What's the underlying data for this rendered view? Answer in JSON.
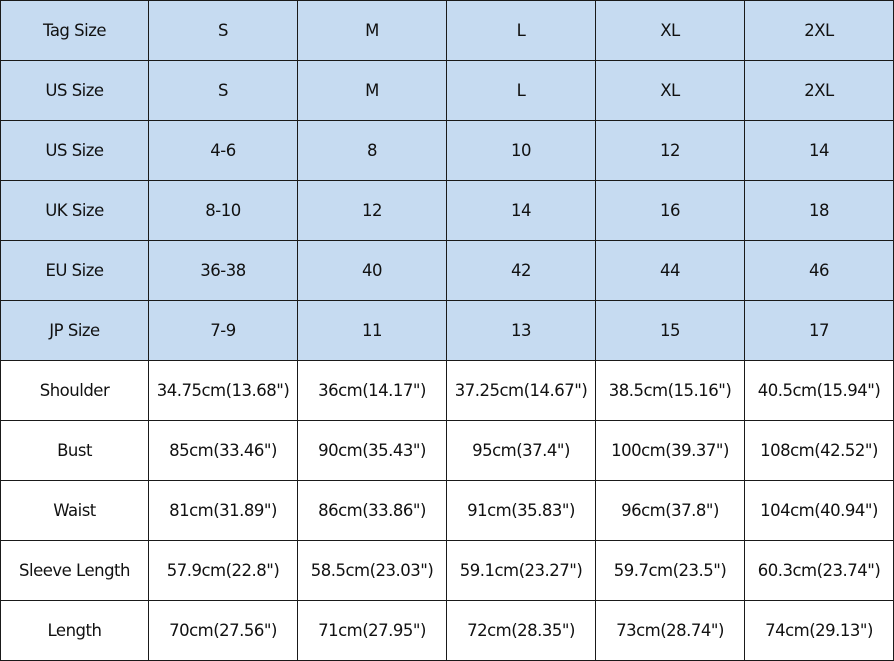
{
  "colors": {
    "header_bg": "#c6dbf1",
    "body_bg": "#ffffff",
    "border": "#1a1a1a"
  },
  "size_rows": [
    {
      "label": "Tag Size",
      "values": [
        "S",
        "M",
        "L",
        "XL",
        "2XL"
      ]
    },
    {
      "label": "US Size",
      "values": [
        "S",
        "M",
        "L",
        "XL",
        "2XL"
      ]
    },
    {
      "label": "US Size",
      "values": [
        "4-6",
        "8",
        "10",
        "12",
        "14"
      ]
    },
    {
      "label": "UK Size",
      "values": [
        "8-10",
        "12",
        "14",
        "16",
        "18"
      ]
    },
    {
      "label": "EU Size",
      "values": [
        "36-38",
        "40",
        "42",
        "44",
        "46"
      ]
    },
    {
      "label": "JP Size",
      "values": [
        "7-9",
        "11",
        "13",
        "15",
        "17"
      ]
    }
  ],
  "measure_rows": [
    {
      "label": "Shoulder",
      "values": [
        "34.75cm(13.68\")",
        "36cm(14.17\")",
        "37.25cm(14.67\")",
        "38.5cm(15.16\")",
        "40.5cm(15.94\")"
      ]
    },
    {
      "label": "Bust",
      "values": [
        "85cm(33.46\")",
        "90cm(35.43\")",
        "95cm(37.4\")",
        "100cm(39.37\")",
        "108cm(42.52\")"
      ]
    },
    {
      "label": "Waist",
      "values": [
        "81cm(31.89\")",
        "86cm(33.86\")",
        "91cm(35.83\")",
        "96cm(37.8\")",
        "104cm(40.94\")"
      ]
    },
    {
      "label": "Sleeve Length",
      "values": [
        "57.9cm(22.8\")",
        "58.5cm(23.03\")",
        "59.1cm(23.27\")",
        "59.7cm(23.5\")",
        "60.3cm(23.74\")"
      ]
    },
    {
      "label": "Length",
      "values": [
        "70cm(27.56\")",
        "71cm(27.95\")",
        "72cm(28.35\")",
        "73cm(28.74\")",
        "74cm(29.13\")"
      ]
    }
  ]
}
